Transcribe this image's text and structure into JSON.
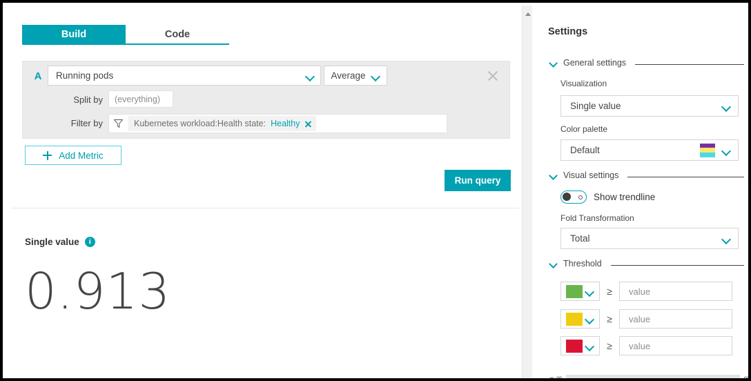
{
  "tabs": [
    {
      "label": "Build",
      "active": true
    },
    {
      "label": "Code",
      "active": false
    }
  ],
  "query": {
    "letter": "A",
    "metric": "Running pods",
    "aggregation": "Average",
    "split_by_label": "Split by",
    "split_by_value": "(everything)",
    "filter_by_label": "Filter by",
    "filter_chip_key": "Kubernetes workload:Health state:",
    "filter_chip_value": "Healthy",
    "remove_metric_icon": "close-icon",
    "filter_icon": "funnel-icon"
  },
  "actions": {
    "add_metric": "Add Metric",
    "run_query": "Run query"
  },
  "result": {
    "title": "Single value",
    "info_icon": "info-icon",
    "info_glyph": "i",
    "value": "0.913"
  },
  "settings": {
    "title": "Settings",
    "general": {
      "heading": "General settings",
      "visualization_label": "Visualization",
      "visualization_value": "Single value",
      "color_palette_label": "Color palette",
      "color_palette_value": "Default",
      "palette_colors": [
        "#7b2f9e",
        "#f6e96b",
        "#4fd8e8"
      ]
    },
    "visual": {
      "heading": "Visual settings",
      "trendline_label": "Show trendline",
      "trendline_on": false,
      "fold_label": "Fold Transformation",
      "fold_value": "Total"
    },
    "threshold": {
      "heading": "Threshold",
      "operator": "≥",
      "rows": [
        {
          "color": "#6ab54b",
          "placeholder": "value",
          "value": ""
        },
        {
          "color": "#f0cc11",
          "placeholder": "value",
          "value": ""
        },
        {
          "color": "#db1332",
          "placeholder": "value",
          "value": ""
        }
      ],
      "slider_min": "− ∞",
      "slider_max": "∞"
    }
  },
  "colors": {
    "accent": "#00a1b2",
    "accent_light": "#56cbe0",
    "text": "#454646"
  }
}
